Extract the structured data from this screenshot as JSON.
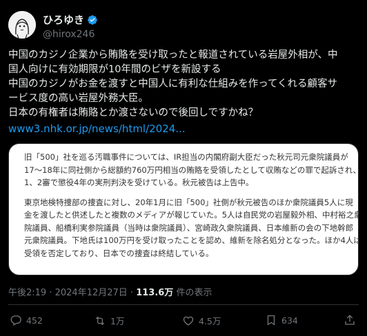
{
  "author": {
    "display_name": "ひろゆき",
    "handle": "@hirox246"
  },
  "tweet": {
    "lines": [
      "中国のカジノ企業から賄賂を受け取ったと報道されている岩屋外相が、中",
      "国人向けに有効期限が10年間のビザを新設する",
      "中国のカジノがお金を渡すと中国人に有利な仕組みを作ってくれる顧客サ",
      "ービス度の高い岩屋外務大臣。",
      "日本の有権者は賄賂とか渡さないので後回しですかね？"
    ],
    "link": "www3.nhk.or.jp/news/html/2024..."
  },
  "card": {
    "paragraph1": [
      "旧「500」社を巡る汚職事件については、IR担当の内閣府副大臣だった秋元司元衆院議員が",
      "17〜18年に同社側から総額約760万円相当の賄賂を受領したとして収賄などの罪で起訴され、",
      "1、2審で懲役4年の実刑判決を受けている。秋元被告は上告中。"
    ],
    "paragraph2": [
      "東京地検特捜部の捜査に対し、20年1月に旧「500」社側が秋元被告のほか衆院議員5人に現",
      "金を渡したと供述したと複数のメディアが報じていた。5人は自民党の岩屋毅外相、中村裕之衆",
      "院議員、船橋利実参院議員（当時は衆院議員）、宮崎政久衆院議員、日本維新の会の下地幹郎",
      "元衆院議員。下地氏は100万円を受け取ったことを認め、維新を除名処分となった。ほか4人は",
      "受領を否定しており、日本での捜査は終結している。"
    ]
  },
  "meta": {
    "time": "午後2:19",
    "separator": " · ",
    "date": "2024年12月27日",
    "views": "113.6万",
    "views_suffix": " 件の表示"
  },
  "actions": {
    "replies": "452",
    "reposts": "1万",
    "likes": "4.5万",
    "bookmarks": "634"
  },
  "colors": {
    "accent": "#1d9bf0",
    "background": "#000000",
    "muted": "#71767b"
  }
}
